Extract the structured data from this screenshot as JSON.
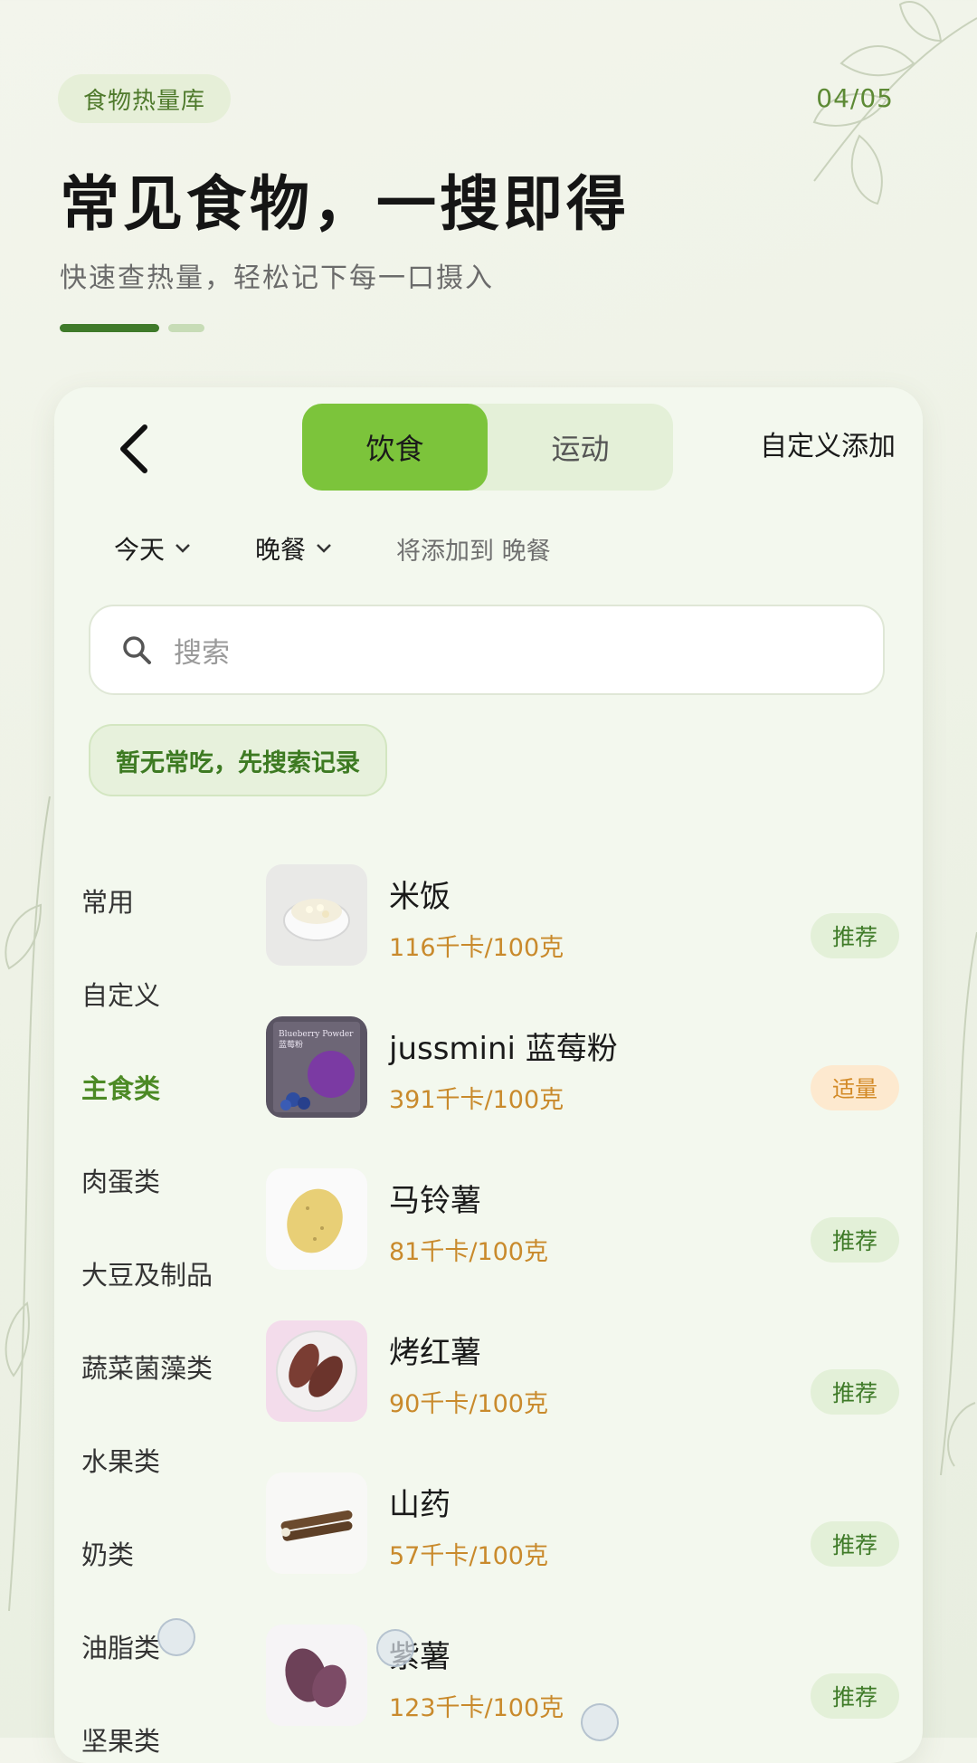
{
  "header": {
    "tag": "食物热量库",
    "pager": "04/05",
    "title": "常见食物，一搜即得",
    "subtitle": "快速查热量，轻松记下每一口摄入"
  },
  "toolbar": {
    "tabs": [
      {
        "label": "饮食",
        "active": true
      },
      {
        "label": "运动",
        "active": false
      }
    ],
    "custom_add": "自定义添加"
  },
  "filters": {
    "day": "今天",
    "meal": "晚餐",
    "hint": "将添加到 晚餐"
  },
  "search": {
    "placeholder": "搜索"
  },
  "recent_chip": "暂无常吃，先搜索记录",
  "categories": [
    {
      "label": "常用",
      "active": false
    },
    {
      "label": "自定义",
      "active": false
    },
    {
      "label": "主食类",
      "active": true
    },
    {
      "label": "肉蛋类",
      "active": false
    },
    {
      "label": "大豆及制品",
      "active": false
    },
    {
      "label": "蔬菜菌藻类",
      "active": false
    },
    {
      "label": "水果类",
      "active": false
    },
    {
      "label": "奶类",
      "active": false
    },
    {
      "label": "油脂类",
      "active": false
    },
    {
      "label": "坚果类",
      "active": false
    }
  ],
  "foods": [
    {
      "name": "米饭",
      "calories": "116千卡/100克",
      "badge": "推荐",
      "badge_type": "green"
    },
    {
      "name": "jussmini 蓝莓粉",
      "calories": "391千卡/100克",
      "badge": "适量",
      "badge_type": "orange"
    },
    {
      "name": "马铃薯",
      "calories": "81千卡/100克",
      "badge": "推荐",
      "badge_type": "green"
    },
    {
      "name": "烤红薯",
      "calories": "90千卡/100克",
      "badge": "推荐",
      "badge_type": "green"
    },
    {
      "name": "山药",
      "calories": "57千卡/100克",
      "badge": "推荐",
      "badge_type": "green"
    },
    {
      "name": "紫薯",
      "calories": "123千卡/100克",
      "badge": "推荐",
      "badge_type": "green"
    }
  ],
  "thumb_labels": {
    "blueberry_line1": "Blueberry Powder",
    "blueberry_line2": "蓝莓粉"
  },
  "colors": {
    "accent": "#7cc43b",
    "accent_dark": "#3f7a2a",
    "calorie": "#c98a2c"
  }
}
